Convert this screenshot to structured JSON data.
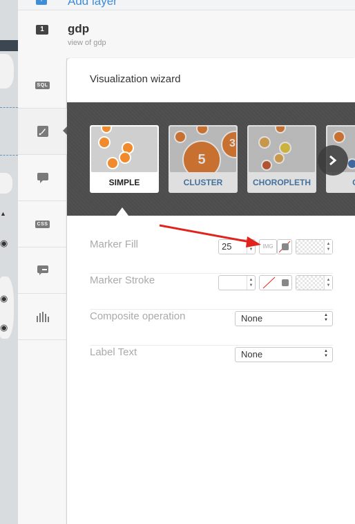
{
  "add_layer": {
    "badge": "+",
    "label": "Add layer"
  },
  "layer": {
    "number": "1",
    "name": "gdp",
    "subtitle": "view of gdp"
  },
  "sidebar": {
    "items": [
      {
        "label": "SQL",
        "icon": "sql-icon"
      },
      {
        "label": "",
        "icon": "wizard-brush-icon"
      },
      {
        "label": "",
        "icon": "infowindow-icon"
      },
      {
        "label": "CSS",
        "icon": "css-icon"
      },
      {
        "label": "",
        "icon": "legend-icon"
      },
      {
        "label": "",
        "icon": "bar-chart-icon"
      }
    ]
  },
  "panel": {
    "title": "Visualization wizard",
    "viz_types": [
      {
        "label": "SIMPLE",
        "selected": true
      },
      {
        "label": "CLUSTER",
        "selected": false,
        "badge_large": "5",
        "badge_small": "3"
      },
      {
        "label": "CHOROPLETH",
        "selected": false
      },
      {
        "label": "CAT",
        "selected": false
      }
    ],
    "next_icon": "chevron-right-icon"
  },
  "form": {
    "marker_fill": {
      "label": "Marker Fill",
      "size": "25",
      "img_label": "IMG"
    },
    "marker_stroke": {
      "label": "Marker Stroke",
      "width": ""
    },
    "composite_operation": {
      "label": "Composite operation",
      "value": "None"
    },
    "label_text": {
      "label": "Label Text",
      "value": "None"
    }
  },
  "colors": {
    "accent_blue": "#3f8dd6",
    "simple_orange": "#f08a2c",
    "annotation_red": "#e0241d"
  }
}
